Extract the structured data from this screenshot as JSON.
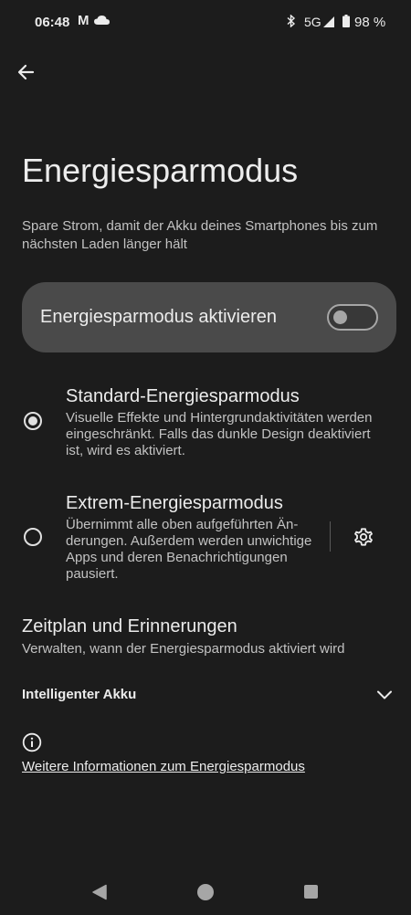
{
  "status_bar": {
    "time": "06:48",
    "notification_glyph": "M",
    "network": "5G",
    "battery": "98 %",
    "icons": [
      "cloud-icon",
      "bluetooth-icon",
      "signal-icon",
      "battery-icon"
    ]
  },
  "header": {
    "back_icon": "arrow-left-icon",
    "title": "Energiesparmodus",
    "subtitle": "Spare Strom, damit der Akku deines Smartphones bis zum nächsten Laden länger hält"
  },
  "main_toggle": {
    "label": "Energiesparmodus aktivieren",
    "enabled": false
  },
  "options": {
    "standard": {
      "title": "Standard-Energiesparmodus",
      "description": "Visuelle Effekte und Hintergrundaktivitäten werden eingeschränkt. Falls das dunkle Design deaktiviert ist, wird es aktiviert.",
      "selected": true
    },
    "extreme": {
      "title": "Extrem-Energiesparmodus",
      "description": "Übernimmt alle oben aufgeführten Än­derungen. Außerdem werden unwichtige Apps und deren Benachrichtigungen pausiert.",
      "selected": false,
      "settings_icon": "gear-icon"
    }
  },
  "schedule": {
    "title": "Zeitplan und Erinnerungen",
    "description": "Verwalten, wann der Energiesparmodus aktiviert wird"
  },
  "smart_battery": {
    "label": "Intelligenter Akku",
    "expand_icon": "chevron-down-icon"
  },
  "footer": {
    "info_icon": "info-icon",
    "link": "Weitere Informationen zum Energiesparmodus"
  },
  "colors": {
    "background": "#1c1c1c",
    "card": "#4a4a4a",
    "text_primary": "#ececec",
    "text_secondary": "#c2c2c2"
  }
}
